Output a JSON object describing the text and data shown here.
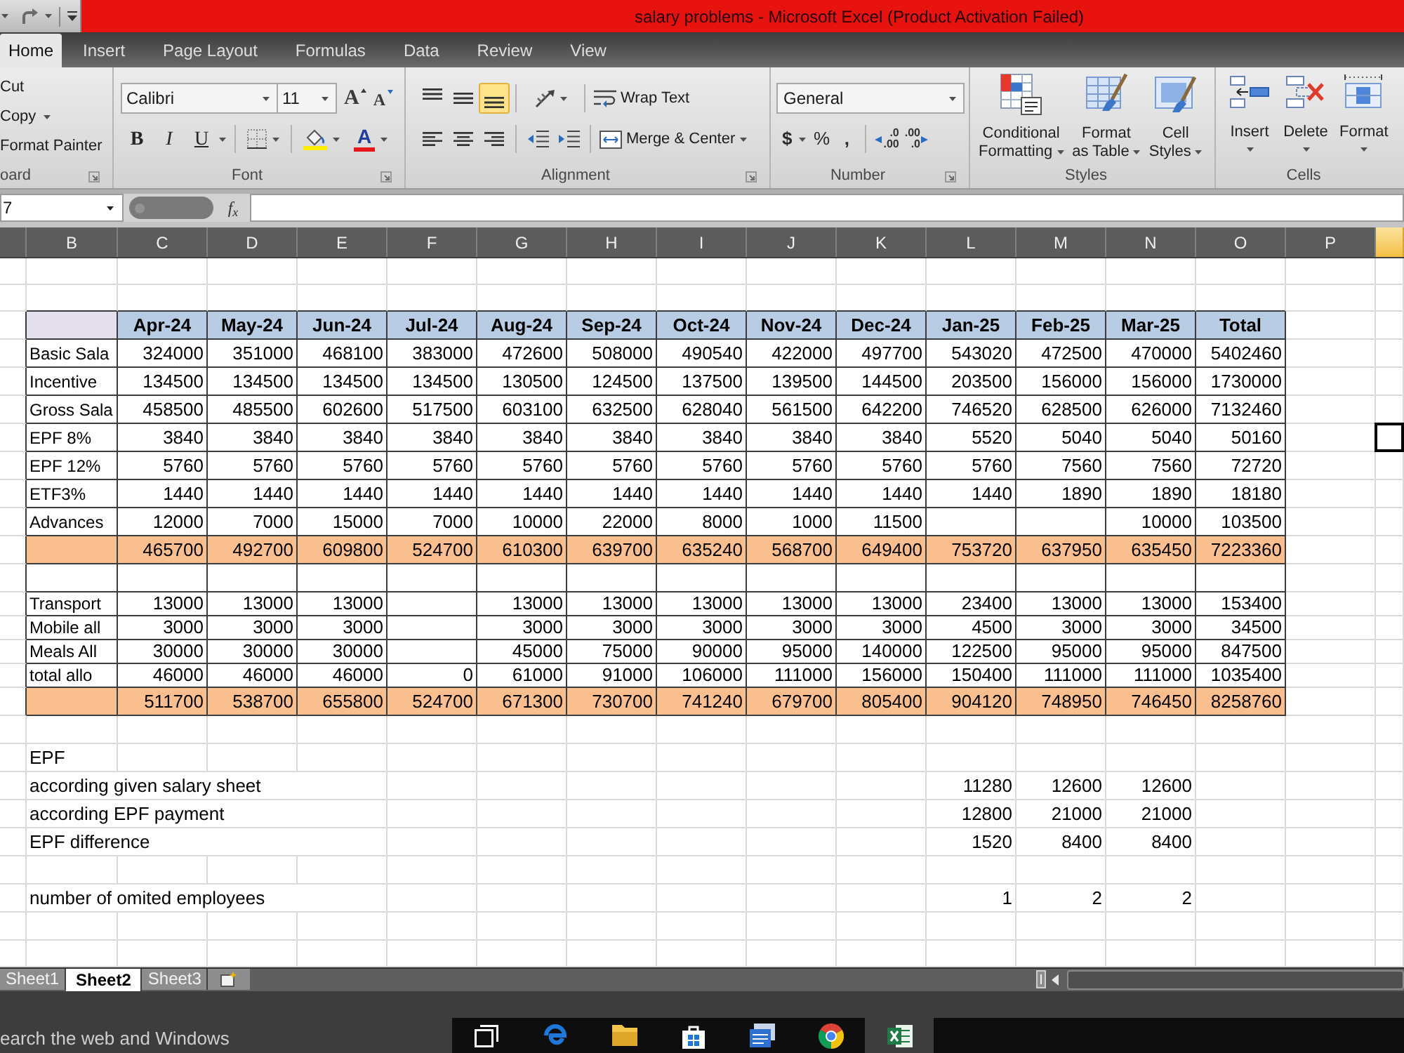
{
  "window": {
    "title": "salary problems - Microsoft Excel (Product Activation Failed)"
  },
  "ribbon_tabs": [
    {
      "label": "Home",
      "selected": true
    },
    {
      "label": "Insert",
      "selected": false
    },
    {
      "label": "Page Layout",
      "selected": false
    },
    {
      "label": "Formulas",
      "selected": false
    },
    {
      "label": "Data",
      "selected": false
    },
    {
      "label": "Review",
      "selected": false
    },
    {
      "label": "View",
      "selected": false
    }
  ],
  "ribbon": {
    "clipboard": {
      "commands": [
        {
          "kind": "cut",
          "label": "Cut"
        },
        {
          "kind": "copy",
          "label": "Copy"
        },
        {
          "kind": "format_painter",
          "label": "Format Painter"
        }
      ],
      "label": "oard"
    },
    "font": {
      "font_name": "Calibri",
      "font_size": "11",
      "size_buttons": [
        {
          "kind": "grow",
          "glyph": "A"
        },
        {
          "kind": "shrink",
          "glyph": "A"
        }
      ],
      "style_buttons": [
        {
          "kind": "bold",
          "glyph": "B"
        },
        {
          "kind": "italic",
          "glyph": "I"
        },
        {
          "kind": "underline",
          "glyph": "U"
        }
      ],
      "font_color_glyph": "A",
      "label": "Font"
    },
    "alignment": {
      "vertical_align": [
        {
          "kind": "top",
          "selected": false
        },
        {
          "kind": "middle",
          "selected": false
        },
        {
          "kind": "bottom",
          "selected": true
        }
      ],
      "wrap_text": "Wrap Text",
      "merge_center": "Merge & Center",
      "label": "Alignment"
    },
    "number": {
      "format": "General",
      "symbol_buttons": [
        {
          "kind": "currency",
          "glyph": "$"
        },
        {
          "kind": "percent",
          "glyph": "%"
        },
        {
          "kind": "comma",
          "glyph": ","
        }
      ],
      "decimal_buttons": [
        {
          "kind": "increase",
          "lines": [
            ".0",
            ".00"
          ]
        },
        {
          "kind": "decrease",
          "lines": [
            ".00",
            ".0"
          ]
        }
      ],
      "label": "Number"
    },
    "styles": {
      "commands": [
        {
          "kind": "conditional_formatting",
          "lines": [
            "Conditional",
            "Formatting"
          ]
        },
        {
          "kind": "format_as_table",
          "lines": [
            "Format",
            "as Table"
          ]
        },
        {
          "kind": "cell_styles",
          "lines": [
            "Cell",
            "Styles"
          ]
        }
      ],
      "label": "Styles"
    },
    "cells": {
      "commands": [
        {
          "kind": "insert",
          "label": "Insert"
        },
        {
          "kind": "delete",
          "label": "Delete"
        },
        {
          "kind": "format",
          "label": "Format"
        }
      ],
      "label": "Cells"
    }
  },
  "formula_bar": {
    "name_box": "7",
    "function_button": "f$_{x}$"
  },
  "column_headers": [
    {
      "label": "B",
      "selected": false
    },
    {
      "label": "C",
      "selected": false
    },
    {
      "label": "D",
      "selected": false
    },
    {
      "label": "E",
      "selected": false
    },
    {
      "label": "F",
      "selected": false
    },
    {
      "label": "G",
      "selected": false
    },
    {
      "label": "H",
      "selected": false
    },
    {
      "label": "I",
      "selected": false
    },
    {
      "label": "J",
      "selected": false
    },
    {
      "label": "K",
      "selected": false
    },
    {
      "label": "L",
      "selected": false
    },
    {
      "label": "M",
      "selected": false
    },
    {
      "label": "N",
      "selected": false
    },
    {
      "label": "O",
      "selected": false
    },
    {
      "label": "P",
      "selected": false
    },
    {
      "selected": true
    }
  ],
  "salary_table": {
    "columns": [
      "Apr-24",
      "May-24",
      "Jun-24",
      "Jul-24",
      "Aug-24",
      "Sep-24",
      "Oct-24",
      "Nov-24",
      "Dec-24",
      "Jan-25",
      "Feb-25",
      "Mar-25",
      "Total"
    ],
    "rows": [
      {
        "kind": "data",
        "label": "Basic Sala",
        "values": {
          "C": "324000",
          "D": "351000",
          "E": "468100",
          "F": "383000",
          "G": "472600",
          "H": "508000",
          "I": "490540",
          "J": "422000",
          "K": "497700",
          "L": "543020",
          "M": "472500",
          "N": "470000",
          "O": "5402460"
        },
        "active_cell": false
      },
      {
        "kind": "data",
        "label": "Incentive",
        "values": {
          "C": "134500",
          "D": "134500",
          "E": "134500",
          "F": "134500",
          "G": "130500",
          "H": "124500",
          "I": "137500",
          "J": "139500",
          "K": "144500",
          "L": "203500",
          "M": "156000",
          "N": "156000",
          "O": "1730000"
        },
        "active_cell": false
      },
      {
        "kind": "data",
        "label": "Gross Sala",
        "values": {
          "C": "458500",
          "D": "485500",
          "E": "602600",
          "F": "517500",
          "G": "603100",
          "H": "632500",
          "I": "628040",
          "J": "561500",
          "K": "642200",
          "L": "746520",
          "M": "628500",
          "N": "626000",
          "O": "7132460"
        },
        "active_cell": false
      },
      {
        "kind": "data",
        "label": "EPF 8%",
        "values": {
          "C": "3840",
          "D": "3840",
          "E": "3840",
          "F": "3840",
          "G": "3840",
          "H": "3840",
          "I": "3840",
          "J": "3840",
          "K": "3840",
          "L": "5520",
          "M": "5040",
          "N": "5040",
          "O": "50160"
        },
        "active_cell": true
      },
      {
        "kind": "data",
        "label": "EPF 12%",
        "values": {
          "C": "5760",
          "D": "5760",
          "E": "5760",
          "F": "5760",
          "G": "5760",
          "H": "5760",
          "I": "5760",
          "J": "5760",
          "K": "5760",
          "L": "5760",
          "M": "7560",
          "N": "7560",
          "O": "72720"
        },
        "active_cell": false
      },
      {
        "kind": "data",
        "label": "ETF3%",
        "values": {
          "C": "1440",
          "D": "1440",
          "E": "1440",
          "F": "1440",
          "G": "1440",
          "H": "1440",
          "I": "1440",
          "J": "1440",
          "K": "1440",
          "L": "1440",
          "M": "1890",
          "N": "1890",
          "O": "18180"
        },
        "active_cell": false
      },
      {
        "kind": "data",
        "label": "Advances",
        "values": {
          "C": "12000",
          "D": "7000",
          "E": "15000",
          "F": "7000",
          "G": "10000",
          "H": "22000",
          "I": "8000",
          "J": "1000",
          "K": "11500",
          "N": "10000",
          "O": "103500"
        },
        "active_cell": false
      },
      {
        "kind": "total",
        "values": {
          "C": "465700",
          "D": "492700",
          "E": "609800",
          "F": "524700",
          "G": "610300",
          "H": "639700",
          "I": "635240",
          "J": "568700",
          "K": "649400",
          "L": "753720",
          "M": "637950",
          "N": "635450",
          "O": "7223360"
        },
        "active_cell": false
      },
      {
        "kind": "blank",
        "active_cell": false
      },
      {
        "kind": "data",
        "label": "Transport",
        "values": {
          "C": "13000",
          "D": "13000",
          "E": "13000",
          "G": "13000",
          "H": "13000",
          "I": "13000",
          "J": "13000",
          "K": "13000",
          "L": "23400",
          "M": "13000",
          "N": "13000",
          "O": "153400"
        },
        "active_cell": false
      },
      {
        "kind": "data",
        "label": "Mobile all",
        "values": {
          "C": "3000",
          "D": "3000",
          "E": "3000",
          "G": "3000",
          "H": "3000",
          "I": "3000",
          "J": "3000",
          "K": "3000",
          "L": "4500",
          "M": "3000",
          "N": "3000",
          "O": "34500"
        },
        "active_cell": false
      },
      {
        "kind": "data",
        "label": "Meals All",
        "values": {
          "C": "30000",
          "D": "30000",
          "E": "30000",
          "G": "45000",
          "H": "75000",
          "I": "90000",
          "J": "95000",
          "K": "140000",
          "L": "122500",
          "M": "95000",
          "N": "95000",
          "O": "847500"
        },
        "active_cell": false
      },
      {
        "kind": "data",
        "label": "total allo",
        "values": {
          "C": "46000",
          "D": "46000",
          "E": "46000",
          "F": "0",
          "G": "61000",
          "H": "91000",
          "I": "106000",
          "J": "111000",
          "K": "156000",
          "L": "150400",
          "M": "111000",
          "N": "111000",
          "O": "1035400"
        },
        "active_cell": false
      },
      {
        "kind": "total",
        "values": {
          "C": "511700",
          "D": "538700",
          "E": "655800",
          "F": "524700",
          "G": "671300",
          "H": "730700",
          "I": "741240",
          "J": "679700",
          "K": "805400",
          "L": "904120",
          "M": "748950",
          "N": "746450",
          "O": "8258760"
        },
        "active_cell": false
      }
    ]
  },
  "epf_section": {
    "rows": [
      {
        "kind": "heading",
        "label": "EPF"
      },
      {
        "kind": "values",
        "label": "according given salary sheet",
        "values": [
          "11280",
          "12600",
          "12600"
        ]
      },
      {
        "kind": "values",
        "label": "according EPF payment",
        "values": [
          "12800",
          "21000",
          "21000"
        ]
      },
      {
        "kind": "values",
        "label": "EPF difference",
        "values": [
          "1520",
          "8400",
          "8400"
        ]
      },
      {
        "kind": "blank"
      },
      {
        "kind": "values",
        "label": "number of omited employees",
        "values": [
          "1",
          "2",
          "2"
        ]
      }
    ]
  },
  "sheet_tabs": [
    {
      "label": "Sheet1",
      "selected": false
    },
    {
      "label": "Sheet2",
      "selected": true
    },
    {
      "label": "Sheet3",
      "selected": false
    }
  ],
  "taskbar": {
    "search": {
      "placeholder": "earch the web and Windows"
    },
    "apps": [
      {
        "kind": "task_view",
        "active": false
      },
      {
        "kind": "browser_e",
        "active": false
      },
      {
        "kind": "folder",
        "active": false
      },
      {
        "kind": "store_bag",
        "active": false
      },
      {
        "kind": "document_stack",
        "active": false
      },
      {
        "kind": "ring_logo",
        "active": false
      },
      {
        "kind": "spreadsheet",
        "active": true
      }
    ]
  }
}
